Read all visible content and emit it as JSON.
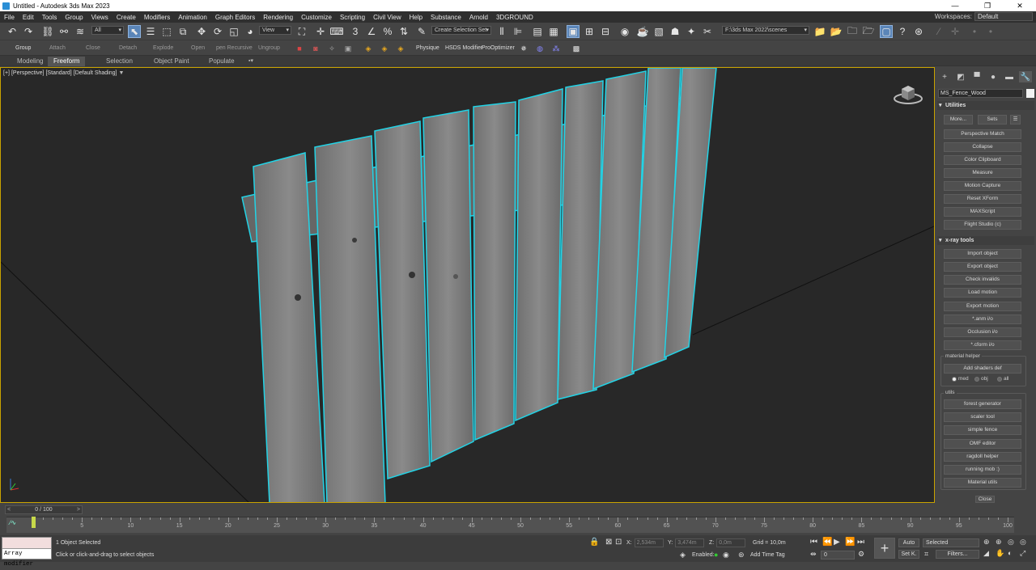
{
  "window": {
    "title": "Untitled - Autodesk 3ds Max 2023",
    "buttons": {
      "minimize": "—",
      "restore": "❐",
      "close": "✕"
    }
  },
  "menu": {
    "items": [
      "File",
      "Edit",
      "Tools",
      "Group",
      "Views",
      "Create",
      "Modifiers",
      "Animation",
      "Graph Editors",
      "Rendering",
      "Customize",
      "Scripting",
      "Civil View",
      "Help",
      "Substance",
      "Arnold",
      "3DGROUND"
    ],
    "workspace_label": "Workspaces:",
    "workspace_value": "Default"
  },
  "toolbar": {
    "selection_filter": "All",
    "ref_coord": "View",
    "selection_set": "Create Selection Set",
    "path": "F:\\3ds Max 2022\\scenes"
  },
  "toolbar2": {
    "labels": [
      "Group",
      "Attach",
      "Close",
      "Detach",
      "Explode",
      "Open",
      "pen Recursive",
      "Ungroup"
    ],
    "plugins": [
      "Physique",
      "HSDS Modifier",
      "ProOptimizer"
    ]
  },
  "ribbon": {
    "tabs": [
      "Modeling",
      "Freeform",
      "Selection",
      "Object Paint",
      "Populate"
    ],
    "active": "Freeform"
  },
  "viewport": {
    "labels": [
      "[+]",
      "[Perspective]",
      "[Standard]",
      "[Default Shading]"
    ]
  },
  "panel": {
    "object_name": "MS_Fence_Wood",
    "utilities": {
      "title": "Utilities",
      "more": "More...",
      "sets": "Sets",
      "buttons": [
        "Perspective Match",
        "Collapse",
        "Color Clipboard",
        "Measure",
        "Motion Capture",
        "Reset XForm",
        "MAXScript",
        "Flight Studio (c)"
      ]
    },
    "xray": {
      "title": "x-ray tools",
      "buttons": [
        "Import object",
        "Export object",
        "Check invalids",
        "Load motion",
        "Export motion",
        "*.anm i/o",
        "Occlusion i/o",
        "*.cform i/o"
      ],
      "material_helper": "material helper",
      "add_shaders": "Add shaders def",
      "radios": [
        "med",
        "obj",
        "all"
      ],
      "utils_title": "utils",
      "utils": [
        "forest generator",
        "scaler tool",
        "simple fence",
        "OMF editor",
        "ragdoll helper",
        "running mob :)",
        "Material utils"
      ],
      "close": "Close"
    }
  },
  "timeline": {
    "frame": "0 / 100",
    "ticks": [
      0,
      5,
      10,
      15,
      20,
      25,
      30,
      35,
      40,
      45,
      50,
      55,
      60,
      65,
      70,
      75,
      80,
      85,
      90,
      95,
      100
    ]
  },
  "status": {
    "maxscript_text": "Array modifier",
    "selected": "1 Object Selected",
    "prompt": "Click or click-and-drag to select objects",
    "x_label": "X:",
    "x_value": "2,534m",
    "y_label": "Y:",
    "y_value": "3,474m",
    "z_label": "Z:",
    "z_value": "0,0m",
    "grid": "Grid = 10,0m",
    "enabled": "Enabled:",
    "add_time_tag": "Add Time Tag",
    "auto": "Auto",
    "setk": "Set K.",
    "selected_dd": "Selected",
    "filters": "Filters...",
    "time_value": "0"
  }
}
